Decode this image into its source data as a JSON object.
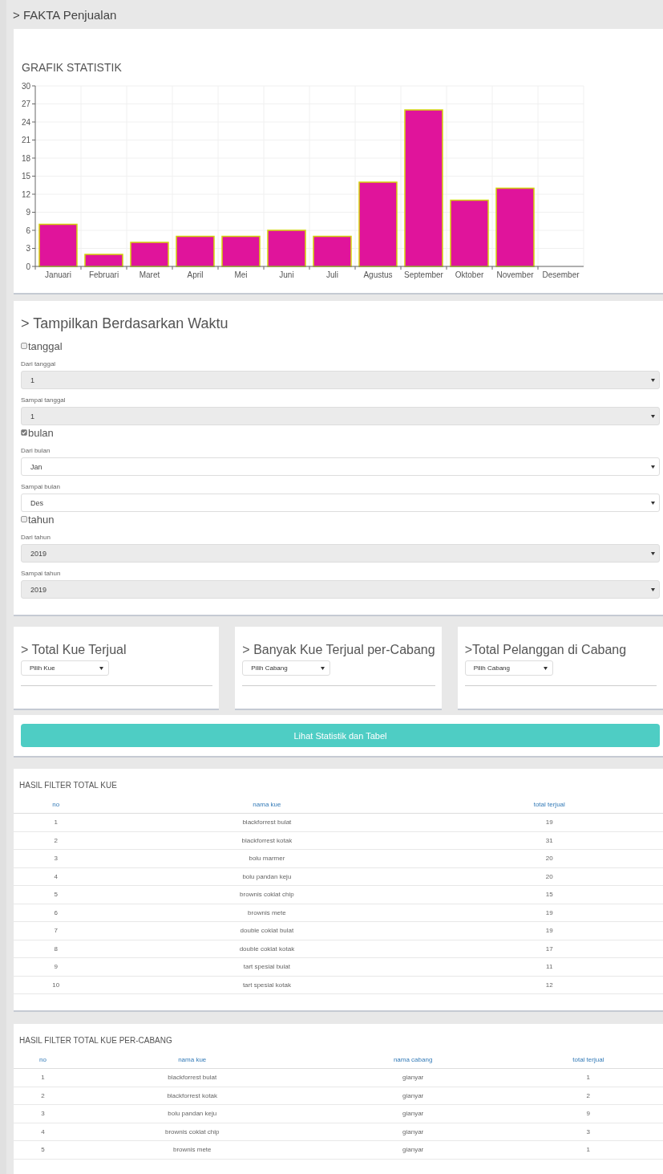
{
  "header": {
    "title": "> FAKTA Penjualan"
  },
  "chart_card": {
    "title": "GRAFIK STATISTIK",
    "chart_data": {
      "type": "bar",
      "categories": [
        "Januari",
        "Februari",
        "Maret",
        "April",
        "Mei",
        "Juni",
        "Juli",
        "Agustus",
        "September",
        "Oktober",
        "November",
        "Desember"
      ],
      "values": [
        7,
        2,
        4,
        5,
        5,
        6,
        5,
        14,
        26,
        11,
        13,
        0
      ],
      "grid": true,
      "ylim": [
        0,
        30
      ],
      "yticks": [
        0,
        3,
        6,
        9,
        12,
        15,
        18,
        21,
        24,
        27,
        30
      ]
    }
  },
  "time_filter": {
    "title": "> Tampilkan Berdasarkan Waktu",
    "groups": [
      {
        "label": "tanggal",
        "checked": false,
        "fields": [
          {
            "label": "Dari tanggal",
            "value": "1",
            "disabled": true
          },
          {
            "label": "Sampai tanggal",
            "value": "1",
            "disabled": true
          }
        ]
      },
      {
        "label": "bulan",
        "checked": true,
        "fields": [
          {
            "label": "Dari bulan",
            "value": "Jan",
            "disabled": false
          },
          {
            "label": "Sampai bulan",
            "value": "Des",
            "disabled": false
          }
        ]
      },
      {
        "label": "tahun",
        "checked": false,
        "fields": [
          {
            "label": "Dari tahun",
            "value": "2019",
            "disabled": true
          },
          {
            "label": "Sampai tahun",
            "value": "2019",
            "disabled": true
          }
        ]
      }
    ]
  },
  "summary_cards": [
    {
      "title": "> Total Kue Terjual",
      "select": "Pilih Kue"
    },
    {
      "title": "> Banyak Kue Terjual per-Cabang",
      "select": "Pilih Cabang"
    },
    {
      "title": ">Total Pelanggan di Cabang",
      "select": "Pilih Cabang"
    }
  ],
  "submit_button": "Lihat Statistik dan Tabel",
  "tables": [
    {
      "title": "HASIL FILTER TOTAL KUE",
      "columns": [
        "no",
        "nama kue",
        "total terjual"
      ],
      "rows": [
        [
          "1",
          "blackforrest bulat",
          "19"
        ],
        [
          "2",
          "blackforrest kotak",
          "31"
        ],
        [
          "3",
          "bolu marmer",
          "20"
        ],
        [
          "4",
          "bolu pandan keju",
          "20"
        ],
        [
          "5",
          "brownis coklat chip",
          "15"
        ],
        [
          "6",
          "brownis mete",
          "19"
        ],
        [
          "7",
          "double coklat bulat",
          "19"
        ],
        [
          "8",
          "double coklat kotak",
          "17"
        ],
        [
          "9",
          "tart spesial bulat",
          "11"
        ],
        [
          "10",
          "tart spesial kotak",
          "12"
        ]
      ]
    },
    {
      "title": "HASIL FILTER TOTAL KUE PER-CABANG",
      "columns": [
        "no",
        "nama kue",
        "nama cabang",
        "total terjual"
      ],
      "rows": [
        [
          "1",
          "blackforrest bulat",
          "gianyar",
          "1"
        ],
        [
          "2",
          "blackforrest kotak",
          "gianyar",
          "2"
        ],
        [
          "3",
          "bolu pandan keju",
          "gianyar",
          "9"
        ],
        [
          "4",
          "brownis coklat chip",
          "gianyar",
          "3"
        ],
        [
          "5",
          "brownis mete",
          "gianyar",
          "1"
        ]
      ]
    }
  ]
}
